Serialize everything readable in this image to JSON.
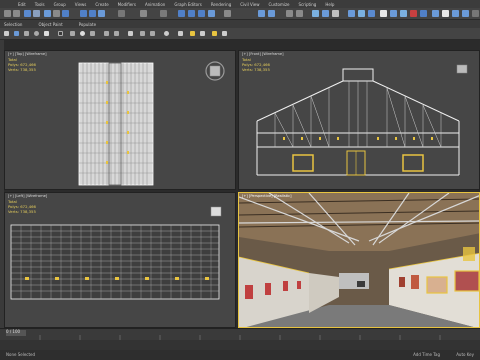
{
  "menu": {
    "items": [
      "Edit",
      "Tools",
      "Group",
      "Views",
      "Create",
      "Modifiers",
      "Animation",
      "Graph Editors",
      "Rendering",
      "Civil View",
      "Customize",
      "Scripting",
      "Help"
    ]
  },
  "ribbon": {
    "tabs": [
      "Selection",
      "Object Paint",
      "Populate"
    ]
  },
  "viewports": {
    "top": {
      "label": "[+] [Top] [Wireframe]",
      "total_label": "Total",
      "polys": "672,466",
      "verts": "738,355"
    },
    "front": {
      "label": "[+] [Front] [Wireframe]",
      "total_label": "Total",
      "polys": "672,466",
      "verts": "738,355"
    },
    "left": {
      "label": "[+] [Left] [Wireframe]",
      "total_label": "Total",
      "polys": "672,466",
      "verts": "738,355"
    },
    "perspective": {
      "label": "[+] [Perspective] [Realistic]"
    }
  },
  "stats_labels": {
    "polys": "Polys:",
    "verts": "Verts:"
  },
  "timeline": {
    "frame": "0 / 100"
  },
  "status": {
    "left": "None Selected",
    "right": "Add Time Tag",
    "right_units": "Auto Key"
  },
  "colors": {
    "accent_yellow": "#e8c440",
    "stats_yellow": "#e8d05c",
    "wire_white": "#ffffff",
    "bg_viewport": "#464646"
  }
}
